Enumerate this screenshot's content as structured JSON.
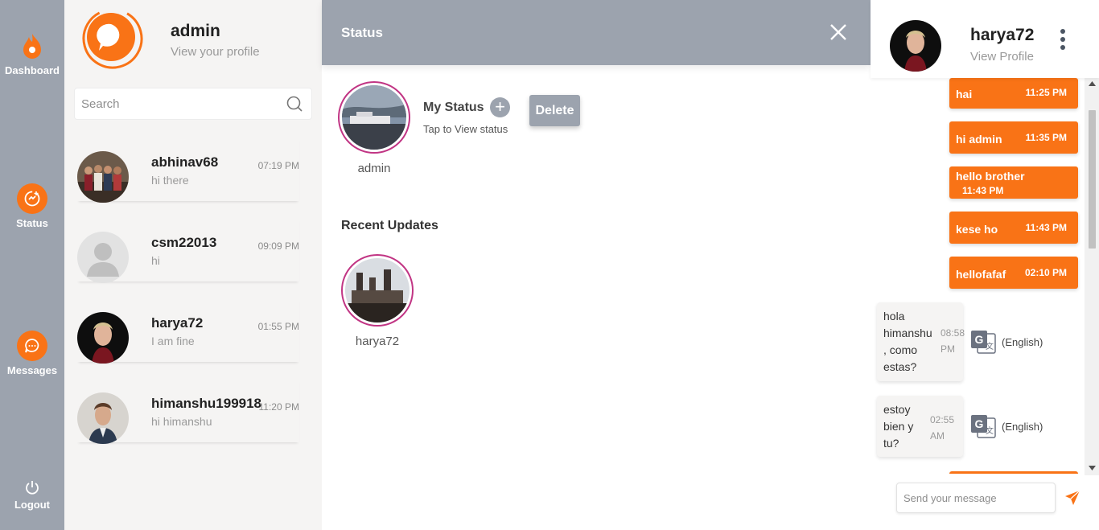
{
  "nav": {
    "dashboard": "Dashboard",
    "status": "Status",
    "messages": "Messages",
    "logout": "Logout"
  },
  "profile": {
    "name": "admin",
    "link": "View your profile"
  },
  "search": {
    "placeholder": "Search"
  },
  "chats": [
    {
      "name": "abhinav68",
      "message": "hi there",
      "time": "07:19 PM"
    },
    {
      "name": "csm22013",
      "message": "hi",
      "time": "09:09 PM"
    },
    {
      "name": "harya72",
      "message": "I am fine",
      "time": "01:55 PM"
    },
    {
      "name": "himanshu199918",
      "message": "hi himanshu",
      "time": "11:20 PM"
    }
  ],
  "status": {
    "title": "Status",
    "my_status": "My Status",
    "tap": "Tap to View status",
    "delete": "Delete",
    "owner": "admin",
    "recent": "Recent Updates",
    "recent_user": "harya72"
  },
  "chat": {
    "name": "harya72",
    "link": "View Profile",
    "outgoing": [
      {
        "text": "hai",
        "time": "11:25 PM"
      },
      {
        "text": "hi admin",
        "time": "11:35 PM"
      },
      {
        "text": "hello brother",
        "time": "11:43 PM"
      },
      {
        "text": "kese ho",
        "time": "11:43 PM"
      },
      {
        "text": "hellofafaf",
        "time": "02:10 PM"
      }
    ],
    "incoming": [
      {
        "lines": [
          "hola",
          "himanshu",
          ", como",
          "estas?"
        ],
        "time": [
          "08:58",
          "PM"
        ],
        "lang": "(English)"
      },
      {
        "lines": [
          "estoy",
          "bien y",
          "tu?"
        ],
        "time": [
          "02:55",
          "AM"
        ],
        "lang": "(English)"
      }
    ],
    "composer_placeholder": "Send your message"
  },
  "colors": {
    "accent": "#f97316",
    "nav": "#9ca3ae",
    "ring": "#c13584"
  }
}
